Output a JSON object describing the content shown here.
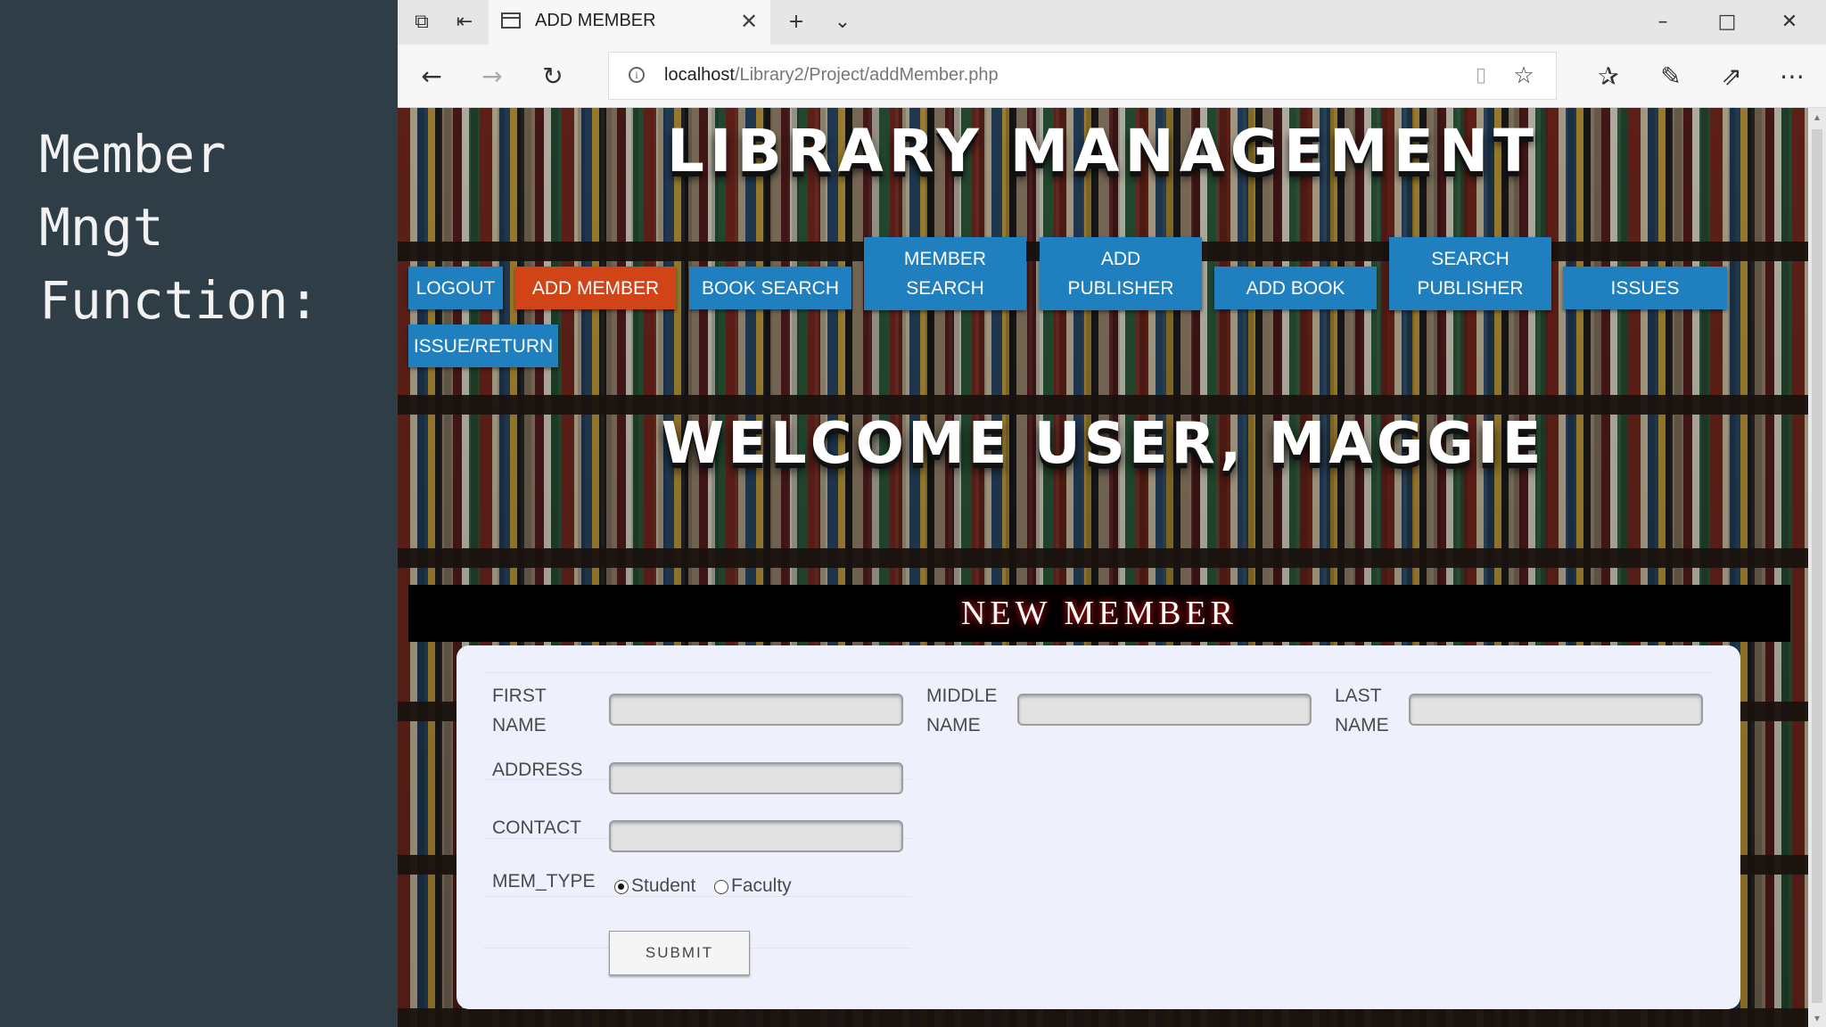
{
  "slide": {
    "title": "Member\nMngt\nFunction:"
  },
  "browser": {
    "tab_title": "ADD MEMBER",
    "url_host": "localhost",
    "url_path": "/Library2/Project/addMember.php"
  },
  "site": {
    "title": "LIBRARY MANAGEMENT",
    "welcome": "WELCOME USER, MAGGIE",
    "menu": [
      {
        "label": "LOGOUT"
      },
      {
        "label": "ADD MEMBER",
        "active": true
      },
      {
        "label": "BOOK SEARCH"
      },
      {
        "label": "MEMBER SEARCH"
      },
      {
        "label": "ADD PUBLISHER"
      },
      {
        "label": "ADD BOOK"
      },
      {
        "label": "SEARCH PUBLISHER"
      },
      {
        "label": "ISSUES"
      },
      {
        "label": "ISSUE/RETURN"
      }
    ],
    "active_color": "#d14417",
    "menu_color": "#1f7fbf"
  },
  "form": {
    "heading": "NEW MEMBER",
    "first_name_label": "FIRST NAME",
    "first_name_value": "",
    "middle_name_label": "MIDDLE NAME",
    "middle_name_value": "",
    "last_name_label": "LAST NAME",
    "last_name_value": "",
    "address_label": "ADDRESS",
    "address_value": "",
    "contact_label": "CONTACT",
    "contact_value": "",
    "mem_type_label": "MEM_TYPE",
    "mem_type_options": [
      "Student",
      "Faculty"
    ],
    "mem_type_selected": "Student",
    "submit_label": "SUBMIT"
  }
}
